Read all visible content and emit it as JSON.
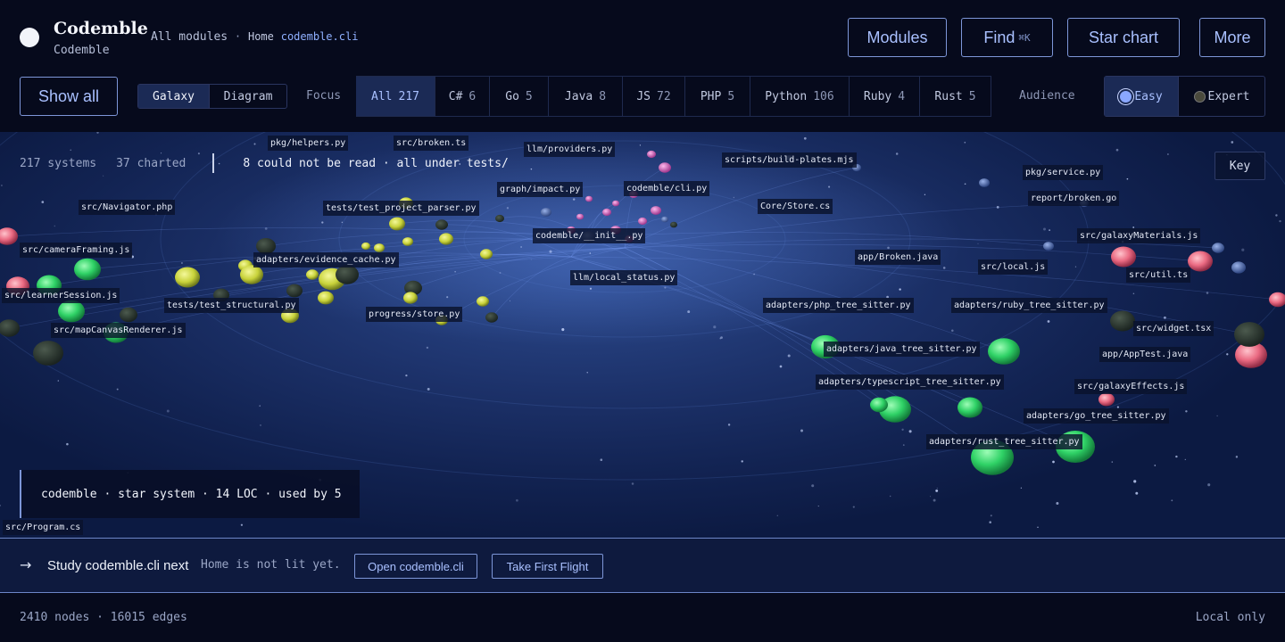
{
  "brand": {
    "title": "Codemble",
    "subtitle": "Codemble",
    "logo_icon": "white-circle-icon"
  },
  "breadcrumb": {
    "root": "All modules",
    "separator": "·",
    "home": "Home",
    "current": "codemble.cli"
  },
  "top_actions": [
    {
      "label": "Modules",
      "kbd": ""
    },
    {
      "label": "Find",
      "kbd": "⌘K"
    },
    {
      "label": "Star chart",
      "kbd": ""
    },
    {
      "label": "More",
      "kbd": ""
    }
  ],
  "toolbar": {
    "show_all": "Show all",
    "views": [
      {
        "label": "Galaxy",
        "active": true
      },
      {
        "label": "Diagram",
        "active": false
      }
    ],
    "focus_label": "Focus",
    "focus_tabs": [
      {
        "label": "All",
        "count": "217",
        "active": true
      },
      {
        "label": "C#",
        "count": "6",
        "active": false
      },
      {
        "label": "Go",
        "count": "5",
        "active": false
      },
      {
        "label": "Java",
        "count": "8",
        "active": false
      },
      {
        "label": "JS",
        "count": "72",
        "active": false
      },
      {
        "label": "PHP",
        "count": "5",
        "active": false
      },
      {
        "label": "Python",
        "count": "106",
        "active": false
      },
      {
        "label": "Ruby",
        "count": "4",
        "active": false
      },
      {
        "label": "Rust",
        "count": "5",
        "active": false
      }
    ],
    "audience_label": "Audience",
    "audience": [
      {
        "label": "Easy",
        "active": true
      },
      {
        "label": "Expert",
        "active": false
      }
    ]
  },
  "galaxy": {
    "stats": {
      "systems": "217 systems",
      "charted": "37 charted",
      "warning": "8 could not be read · all under tests/"
    },
    "key_label": "Key",
    "info_card": "codemble · star system · 14 LOC · used by 5",
    "labels": [
      "pkg/helpers.py",
      "src/broken.ts",
      "llm/providers.py",
      "scripts/build-plates.mjs",
      "pkg/service.py",
      "graph/impact.py",
      "codemble/cli.py",
      "report/broken.go",
      "src/Navigator.php",
      "tests/test_project_parser.py",
      "Core/Store.cs",
      "codemble/__init__.py",
      "src/galaxyMaterials.js",
      "src/cameraFraming.js",
      "app/Broken.java",
      "adapters/evidence_cache.py",
      "src/local.js",
      "src/util.ts",
      "llm/local_status.py",
      "src/learnerSession.js",
      "tests/test_structural.py",
      "adapters/php_tree_sitter.py",
      "adapters/ruby_tree_sitter.py",
      "progress/store.py",
      "src/widget.tsx",
      "src/mapCanvasRenderer.js",
      "adapters/java_tree_sitter.py",
      "app/AppTest.java",
      "adapters/typescript_tree_sitter.py",
      "src/galaxyEffects.js",
      "adapters/go_tree_sitter.py",
      "adapters/rust_tree_sitter.py",
      "src/Program.cs"
    ]
  },
  "next_step": {
    "arrow_icon": "arrow-right-icon",
    "title": "Study codemble.cli next",
    "note": "Home is not lit yet.",
    "open_label": "Open codemble.cli",
    "flight_label": "Take First Flight"
  },
  "footer": {
    "counts": "2410 nodes · 16015 edges",
    "mode": "Local only"
  },
  "colors": {
    "accent": "#a9c0ff",
    "border": "#7d96d8",
    "background": "#060a1c",
    "python_planet": "#d6df4a",
    "adapter_planet": "#3fe07a",
    "js_planet": "#ef6f86",
    "core_cluster": "#e07ad0"
  }
}
